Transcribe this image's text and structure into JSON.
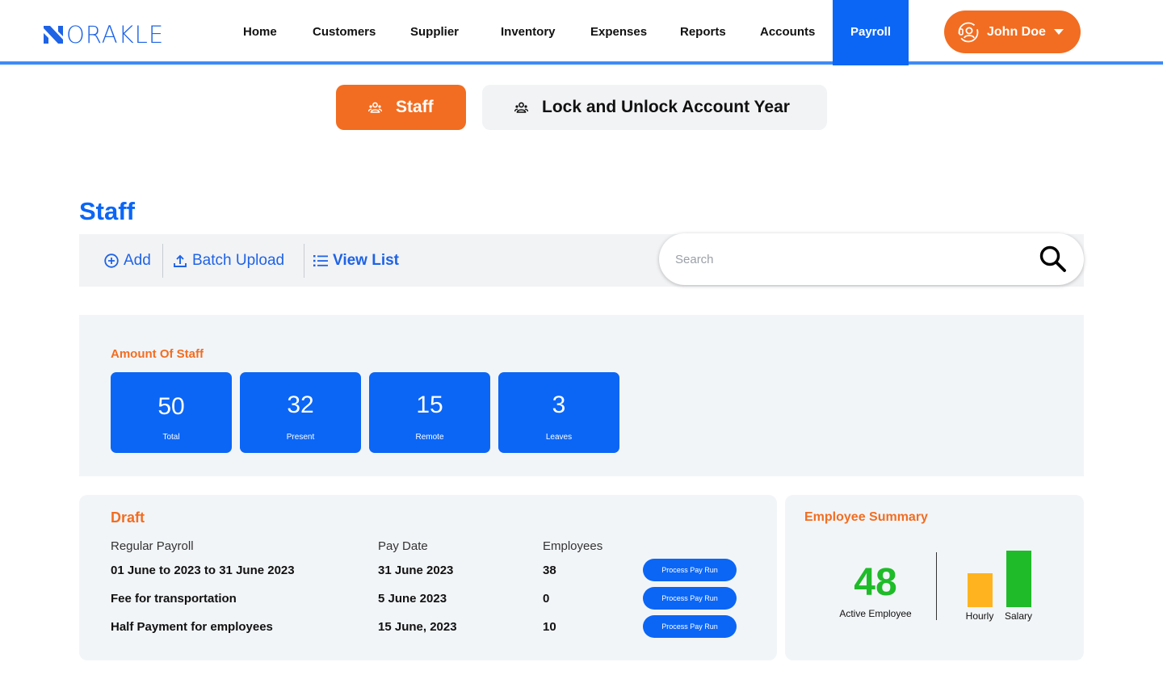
{
  "brand": {
    "name": "ORAKLE",
    "color": "#1e63e6"
  },
  "nav": {
    "items": [
      {
        "label": "Home"
      },
      {
        "label": "Customers"
      },
      {
        "label": "Supplier"
      },
      {
        "label": "Inventory"
      },
      {
        "label": "Expenses"
      },
      {
        "label": "Reports"
      },
      {
        "label": "Accounts"
      },
      {
        "label": "Payroll",
        "active": true
      }
    ],
    "active_color": "#0b66f6"
  },
  "user": {
    "name": "John Doe",
    "icon": "user-support-icon",
    "color": "#f26d21"
  },
  "tabs": [
    {
      "label": "Staff",
      "icon": "group-icon",
      "active": true
    },
    {
      "label": "Lock and Unlock Account Year",
      "icon": "group-icon",
      "active": false
    }
  ],
  "page": {
    "title": "Staff"
  },
  "toolbar": {
    "add_label": "Add",
    "batch_upload_label": "Batch Upload",
    "view_list_label": "View List"
  },
  "search": {
    "placeholder": "Search",
    "value": ""
  },
  "staff_stats": {
    "heading": "Amount Of Staff",
    "cards": [
      {
        "value": "50",
        "label": "Total"
      },
      {
        "value": "32",
        "label": "Present"
      },
      {
        "value": "15",
        "label": "Remote"
      },
      {
        "value": "3",
        "label": "Leaves"
      }
    ]
  },
  "draft": {
    "title": "Draft",
    "columns": [
      "Regular Payroll",
      "Pay Date",
      "Employees"
    ],
    "rows": [
      {
        "name": "01 June to 2023 to 31 June 2023",
        "pay_date": "31 June 2023",
        "employees": "38",
        "action": "Process Pay Run"
      },
      {
        "name": "Fee for transportation",
        "pay_date": "5 June 2023",
        "employees": "0",
        "action": "Process Pay Run"
      },
      {
        "name": "Half Payment for employees",
        "pay_date": "15 June, 2023",
        "employees": "10",
        "action": "Process Pay Run"
      }
    ]
  },
  "employee_summary": {
    "title": "Employee Summary",
    "active_count": "48",
    "active_label": "Active Employee",
    "bars": [
      {
        "label": "Hourly",
        "color": "#ffb41f",
        "relative_value": 0.6
      },
      {
        "label": "Salary",
        "color": "#1fbb29",
        "relative_value": 1.0
      }
    ]
  },
  "colors": {
    "accent": "#f26d21",
    "primary": "#0b66f6",
    "panel": "#f2f5f8"
  }
}
